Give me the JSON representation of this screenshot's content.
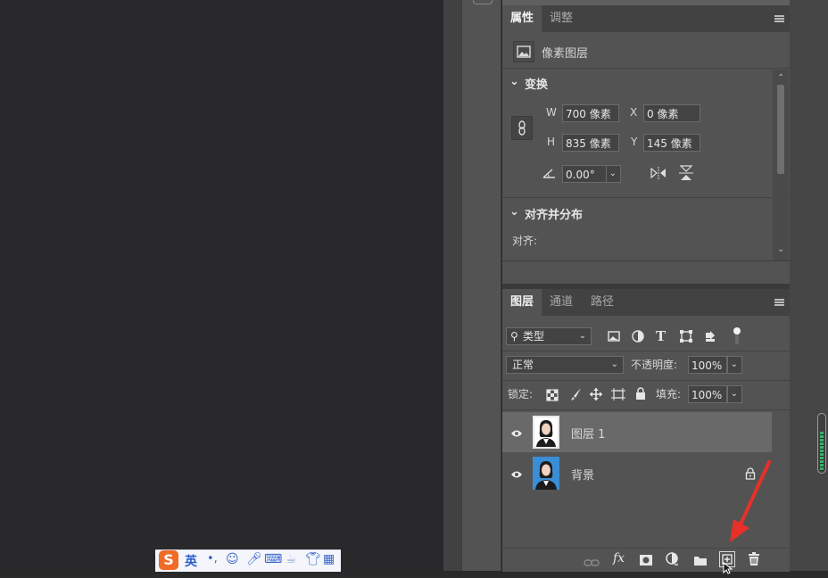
{
  "properties_panel": {
    "tabs": [
      {
        "label": "属性",
        "active": true
      },
      {
        "label": "调整",
        "active": false
      }
    ],
    "layer_type": "像素图层",
    "transform": {
      "section_title": "变换",
      "w_label": "W",
      "w_value": "700 像素",
      "h_label": "H",
      "h_value": "835 像素",
      "x_label": "X",
      "x_value": "0 像素",
      "y_label": "Y",
      "y_value": "145 像素",
      "angle_value": "0.00°"
    },
    "align": {
      "section_title": "对齐并分布",
      "align_label": "对齐:"
    }
  },
  "layers_panel": {
    "tabs": [
      {
        "label": "图层",
        "active": true
      },
      {
        "label": "通道",
        "active": false
      },
      {
        "label": "路径",
        "active": false
      }
    ],
    "filter_kind": "类型",
    "blend_mode": "正常",
    "opacity_label": "不透明度:",
    "opacity_value": "100%",
    "lock_label": "锁定:",
    "fill_label": "填充:",
    "fill_value": "100%",
    "layers": [
      {
        "name": "图层 1",
        "visible": true,
        "selected": true,
        "locked": false
      },
      {
        "name": "背景",
        "visible": true,
        "selected": false,
        "locked": true
      }
    ],
    "bottom_icons": [
      "link-icon",
      "fx-icon",
      "mask-icon",
      "adjustment-icon",
      "folder-icon",
      "new-layer-icon",
      "trash-icon"
    ],
    "fx_text": "fx"
  },
  "ime_toolbar": {
    "logo": "S",
    "lang": "英",
    "icons": [
      "punctuation-icon",
      "emoji-icon",
      "microphone-icon",
      "keyboard-icon",
      "skin-icon",
      "shirt-icon",
      "grid-icon"
    ]
  },
  "annotation": {
    "arrow_color": "#e8302a"
  },
  "colors": {
    "panel": "#535353",
    "canvas": "#29292b",
    "selected_row": "#696969"
  }
}
